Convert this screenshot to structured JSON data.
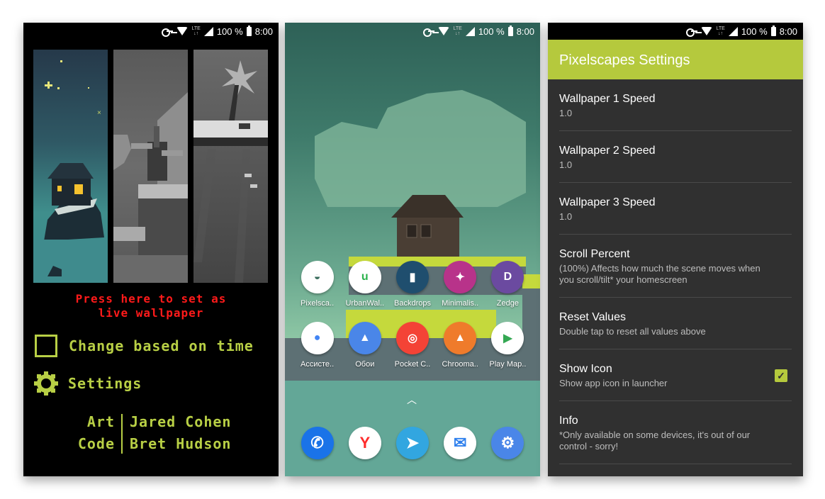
{
  "status_bar": {
    "battery_text": "100 %",
    "time": "8:00",
    "network": "LTE",
    "icons": [
      "vpn-key-icon",
      "wifi-icon",
      "lte-icon",
      "signal-icon",
      "battery-icon"
    ]
  },
  "launcher_screen": {
    "previews": [
      {
        "name": "night-island-preview"
      },
      {
        "name": "windmill-preview"
      },
      {
        "name": "palm-island-preview"
      }
    ],
    "set_wallpaper_line1": "Press here to set as",
    "set_wallpaper_line2": "live wallpaper",
    "change_on_time_label": "Change based on time",
    "change_on_time_checked": false,
    "settings_label": "Settings",
    "credits": [
      {
        "role": "Art",
        "name": "Jared Cohen"
      },
      {
        "role": "Code",
        "name": "Bret Hudson"
      }
    ],
    "colors": {
      "accent": "#b8cf45",
      "cta": "#ff1a1a"
    }
  },
  "home_screen": {
    "apps": [
      {
        "label": "Pixelsca..",
        "icon": "pixelscapes-icon",
        "bg": "#ffffff",
        "fg": "#3b6e5e",
        "glyph": "◒"
      },
      {
        "label": "UrbanWal..",
        "icon": "urbanwalls-icon",
        "bg": "#ffffff",
        "fg": "#2bb24c",
        "glyph": "u"
      },
      {
        "label": "Backdrops",
        "icon": "backdrops-icon",
        "bg": "#1f4e6e",
        "fg": "#ffffff",
        "glyph": "▮"
      },
      {
        "label": "Minimalis..",
        "icon": "minimalist-icon",
        "bg": "#b8338a",
        "fg": "#ffffff",
        "glyph": "✦"
      },
      {
        "label": "Zedge",
        "icon": "zedge-icon",
        "bg": "#6b4aa0",
        "fg": "#ffffff",
        "glyph": "D"
      },
      {
        "label": "Ассисте..",
        "icon": "assistant-icon",
        "bg": "#ffffff",
        "fg": "#4285f4",
        "glyph": "●"
      },
      {
        "label": "Обои",
        "icon": "wallpapers-icon",
        "bg": "#4a86e8",
        "fg": "#ffffff",
        "glyph": "▲"
      },
      {
        "label": "Pocket C..",
        "icon": "pocket-casts-icon",
        "bg": "#f44336",
        "fg": "#ffffff",
        "glyph": "◎"
      },
      {
        "label": "Chrooma..",
        "icon": "chrooma-icon",
        "bg": "#ef7b2b",
        "fg": "#ffffff",
        "glyph": "▲"
      },
      {
        "label": "Play Map..",
        "icon": "play-store-icon",
        "bg": "#ffffff",
        "fg": "#34a853",
        "glyph": "▶"
      }
    ],
    "drawer_icon": "chevron-up-icon",
    "dock": [
      {
        "icon": "phone-icon",
        "bg": "#1a73e8",
        "fg": "#ffffff",
        "glyph": "✆"
      },
      {
        "icon": "yandex-browser-icon",
        "bg": "#ffffff",
        "fg": "#ff2c2c",
        "glyph": "Y"
      },
      {
        "icon": "telegram-icon",
        "bg": "#32a6e0",
        "fg": "#ffffff",
        "glyph": "➤"
      },
      {
        "icon": "inbox-icon",
        "bg": "#ffffff",
        "fg": "#2f80ed",
        "glyph": "✉"
      },
      {
        "icon": "settings-icon",
        "bg": "#4a86e8",
        "fg": "#ffffff",
        "glyph": "⚙"
      }
    ]
  },
  "settings_screen": {
    "title": "Pixelscapes Settings",
    "accent": "#b5c93d",
    "preferences": [
      {
        "title": "Wallpaper 1 Speed",
        "summary": "1.0"
      },
      {
        "title": "Wallpaper 2 Speed",
        "summary": "1.0"
      },
      {
        "title": "Wallpaper 3 Speed",
        "summary": "1.0"
      },
      {
        "title": "Scroll Percent",
        "summary": "(100%) Affects how much the scene moves when you scroll/tilt* your homescreen"
      },
      {
        "title": "Reset Values",
        "summary": "Double tap to reset all values above"
      },
      {
        "title": "Show Icon",
        "summary": "Show app icon in launcher",
        "checked": true
      },
      {
        "title": "Info",
        "summary": "*Only available on some devices, it's out of our control - sorry!"
      }
    ]
  }
}
